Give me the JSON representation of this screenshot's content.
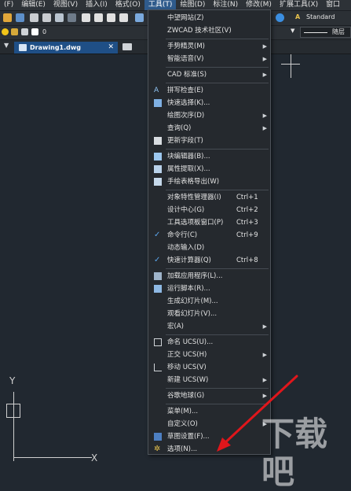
{
  "menubar": {
    "items": [
      {
        "label": "(F)"
      },
      {
        "label": "编辑(E)"
      },
      {
        "label": "视图(V)"
      },
      {
        "label": "插入(I)"
      },
      {
        "label": "格式(O)"
      },
      {
        "label": "工具(T)"
      },
      {
        "label": "绘图(D)"
      },
      {
        "label": "标注(N)"
      },
      {
        "label": "修改(M)"
      },
      {
        "label": "扩展工具(X)"
      },
      {
        "label": "窗口"
      }
    ]
  },
  "toolbar": {
    "text_style": "Standard",
    "layer_value": "0",
    "linetype_value": "随层"
  },
  "tab": {
    "title": "Drawing1.dwg",
    "close": "✕"
  },
  "canvas": {
    "ucs_y": "Y",
    "ucs_x": "X"
  },
  "menu": {
    "items": [
      {
        "label": "中望网站(Z)"
      },
      {
        "label": "ZWCAD 技术社区(V)"
      },
      {
        "label": "手势精灵(M)",
        "submenu": true
      },
      {
        "label": "智能语音(V)",
        "submenu": true
      },
      {
        "label": "CAD 标准(S)",
        "submenu": true
      },
      {
        "label": "拼写检查(E)",
        "icon": "spellcheck-icon"
      },
      {
        "label": "快速选择(K)...",
        "icon": "quick-select-icon"
      },
      {
        "label": "绘图次序(D)",
        "submenu": true
      },
      {
        "label": "查询(Q)",
        "submenu": true
      },
      {
        "label": "更新字段(T)",
        "icon": "update-field-icon"
      },
      {
        "label": "块编辑器(B)...",
        "icon": "block-editor-icon"
      },
      {
        "label": "属性提取(X)...",
        "icon": "attribute-extract-icon"
      },
      {
        "label": "手绘表格导出(W)",
        "icon": "table-export-icon"
      },
      {
        "label": "对象特性管理器(I)",
        "shortcut": "Ctrl+1"
      },
      {
        "label": "设计中心(G)",
        "shortcut": "Ctrl+2"
      },
      {
        "label": "工具选项板窗口(P)",
        "shortcut": "Ctrl+3"
      },
      {
        "label": "命令行(C)",
        "shortcut": "Ctrl+9",
        "checked": true
      },
      {
        "label": "动态输入(D)"
      },
      {
        "label": "快速计算器(Q)",
        "shortcut": "Ctrl+8",
        "checked": true
      },
      {
        "label": "加载应用程序(L)...",
        "icon": "load-app-icon"
      },
      {
        "label": "运行脚本(R)...",
        "icon": "run-script-icon"
      },
      {
        "label": "生成幻灯片(M)..."
      },
      {
        "label": "观看幻灯片(V)..."
      },
      {
        "label": "宏(A)",
        "submenu": true
      },
      {
        "label": "命名 UCS(U)...",
        "icon": "named-ucs-icon"
      },
      {
        "label": "正交 UCS(H)",
        "submenu": true
      },
      {
        "label": "移动 UCS(V)",
        "icon": "move-ucs-icon"
      },
      {
        "label": "新建 UCS(W)",
        "submenu": true
      },
      {
        "label": "谷歌地球(G)",
        "submenu": true
      },
      {
        "label": "菜单(M)..."
      },
      {
        "label": "自定义(O)",
        "submenu": true
      },
      {
        "label": "草图设置(F)...",
        "icon": "drafting-settings-icon"
      },
      {
        "label": "选项(N)...",
        "icon": "options-gear-icon"
      }
    ]
  },
  "colors": {
    "menu_bg": "#25292e",
    "highlight": "#2f5b8c",
    "tab_active": "#1f4f86",
    "check": "#5aa4ea",
    "annotation_arrow": "#e0161b"
  },
  "watermark": {
    "text": "下载吧"
  }
}
